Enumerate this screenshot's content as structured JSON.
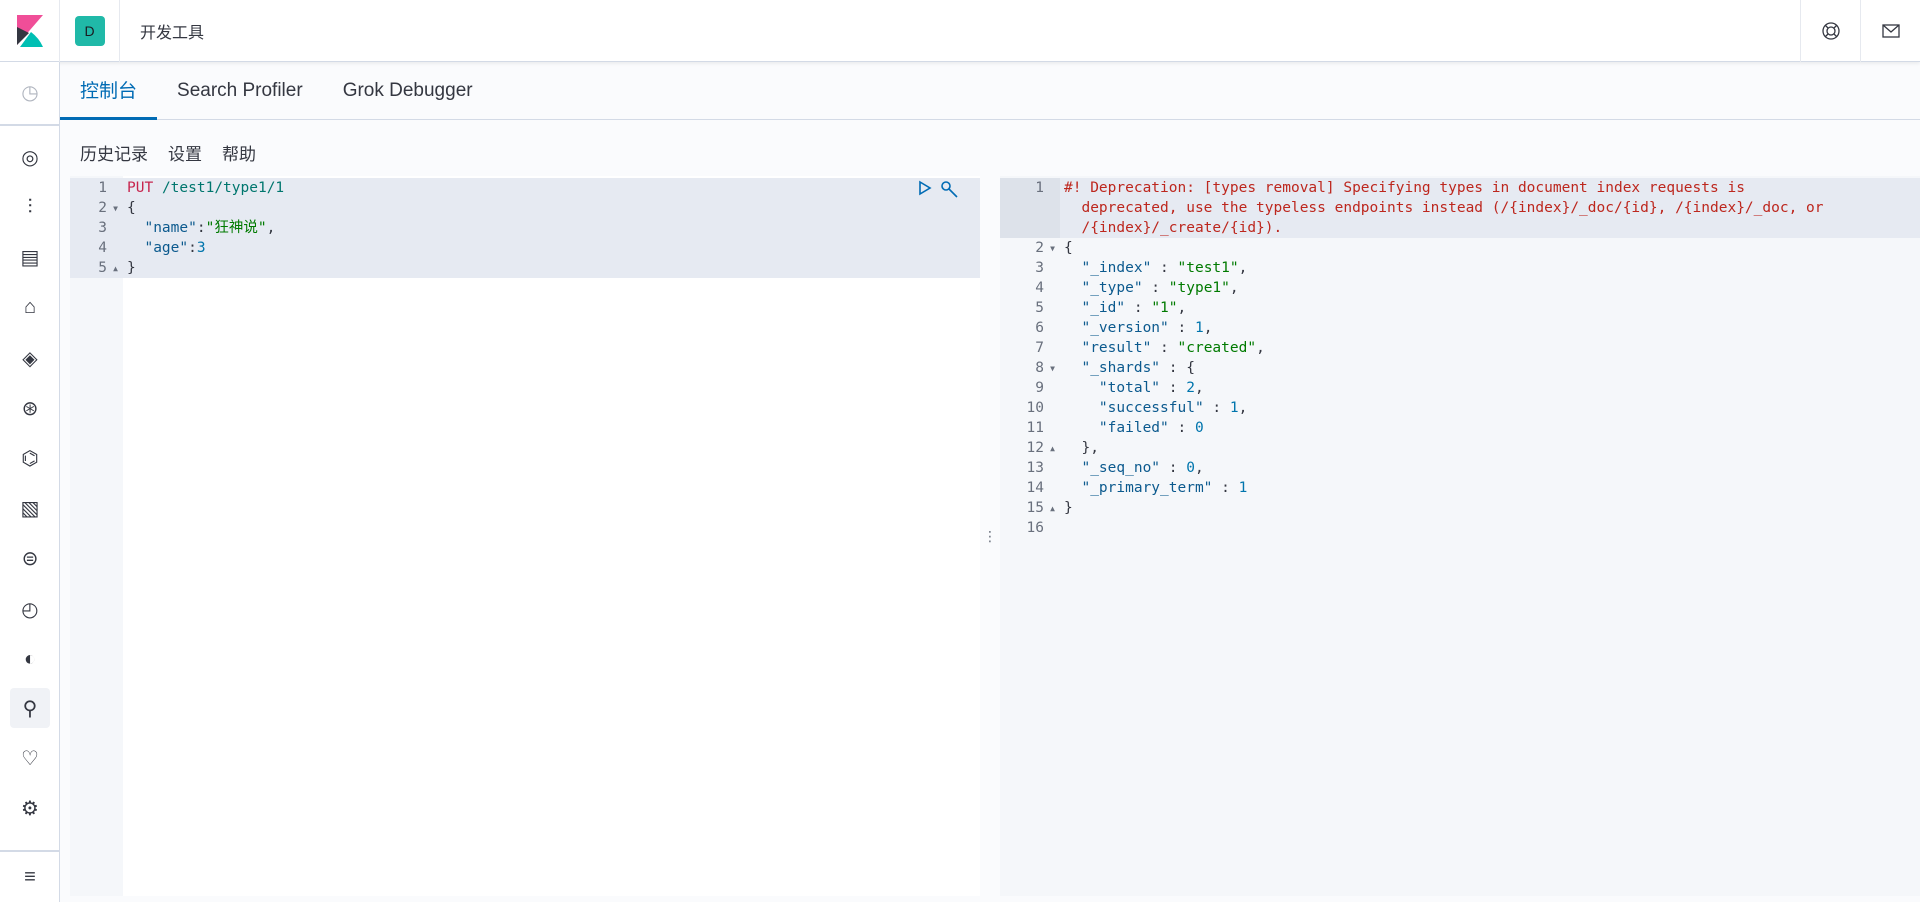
{
  "header": {
    "space_initial": "D",
    "breadcrumb": "开发工具",
    "help_icon": "lifebuoy-icon",
    "mail_icon": "mail-icon"
  },
  "sidebar": {
    "items": [
      "recently-viewed",
      "discover",
      "visualize",
      "dashboard",
      "canvas",
      "maps",
      "machine-learning",
      "infrastructure",
      "logs",
      "apm",
      "uptime",
      "siem",
      "dev-tools",
      "monitoring",
      "management",
      "collapse"
    ],
    "active": "dev-tools"
  },
  "tabs": [
    {
      "label": "控制台",
      "active": true
    },
    {
      "label": "Search Profiler"
    },
    {
      "label": "Grok Debugger"
    }
  ],
  "toolbar": {
    "history": "历史记录",
    "settings": "设置",
    "help": "帮助"
  },
  "request": {
    "lines": [
      [
        [
          "k",
          "PUT"
        ],
        [
          "p",
          " "
        ],
        [
          "u",
          "/test1/type1/1"
        ]
      ],
      [
        [
          "p",
          "{"
        ]
      ],
      [
        [
          "p",
          "  "
        ],
        [
          "key",
          "\"name\""
        ],
        [
          "p",
          ":"
        ],
        [
          "s",
          "\"狂神说\""
        ],
        [
          "p",
          ","
        ]
      ],
      [
        [
          "p",
          "  "
        ],
        [
          "key",
          "\"age\""
        ],
        [
          "p",
          ":"
        ],
        [
          "n",
          "3"
        ]
      ],
      [
        [
          "p",
          "}"
        ]
      ]
    ],
    "folds": {
      "2": "down",
      "5": "up"
    }
  },
  "response": {
    "lines": [
      [
        [
          "c",
          "#! Deprecation: [types removal] Specifying types in document index requests is\n  deprecated, use the typeless endpoints instead (/{index}/_doc/{id}, /{index}/_doc, or\n  /{index}/_create/{id})."
        ]
      ],
      [
        [
          "p",
          "{"
        ]
      ],
      [
        [
          "p",
          "  "
        ],
        [
          "key",
          "\"_index\""
        ],
        [
          "p",
          " : "
        ],
        [
          "s",
          "\"test1\""
        ],
        [
          "p",
          ","
        ]
      ],
      [
        [
          "p",
          "  "
        ],
        [
          "key",
          "\"_type\""
        ],
        [
          "p",
          " : "
        ],
        [
          "s",
          "\"type1\""
        ],
        [
          "p",
          ","
        ]
      ],
      [
        [
          "p",
          "  "
        ],
        [
          "key",
          "\"_id\""
        ],
        [
          "p",
          " : "
        ],
        [
          "s",
          "\"1\""
        ],
        [
          "p",
          ","
        ]
      ],
      [
        [
          "p",
          "  "
        ],
        [
          "key",
          "\"_version\""
        ],
        [
          "p",
          " : "
        ],
        [
          "n",
          "1"
        ],
        [
          "p",
          ","
        ]
      ],
      [
        [
          "p",
          "  "
        ],
        [
          "key",
          "\"result\""
        ],
        [
          "p",
          " : "
        ],
        [
          "s",
          "\"created\""
        ],
        [
          "p",
          ","
        ]
      ],
      [
        [
          "p",
          "  "
        ],
        [
          "key",
          "\"_shards\""
        ],
        [
          "p",
          " : {"
        ]
      ],
      [
        [
          "p",
          "    "
        ],
        [
          "key",
          "\"total\""
        ],
        [
          "p",
          " : "
        ],
        [
          "n",
          "2"
        ],
        [
          "p",
          ","
        ]
      ],
      [
        [
          "p",
          "    "
        ],
        [
          "key",
          "\"successful\""
        ],
        [
          "p",
          " : "
        ],
        [
          "n",
          "1"
        ],
        [
          "p",
          ","
        ]
      ],
      [
        [
          "p",
          "    "
        ],
        [
          "key",
          "\"failed\""
        ],
        [
          "p",
          " : "
        ],
        [
          "n",
          "0"
        ]
      ],
      [
        [
          "p",
          "  },"
        ]
      ],
      [
        [
          "p",
          "  "
        ],
        [
          "key",
          "\"_seq_no\""
        ],
        [
          "p",
          " : "
        ],
        [
          "n",
          "0"
        ],
        [
          "p",
          ","
        ]
      ],
      [
        [
          "p",
          "  "
        ],
        [
          "key",
          "\"_primary_term\""
        ],
        [
          "p",
          " : "
        ],
        [
          "n",
          "1"
        ]
      ],
      [
        [
          "p",
          "}"
        ]
      ],
      [
        [
          "p",
          ""
        ]
      ]
    ],
    "folds": {
      "2": "down",
      "8": "down",
      "12": "up",
      "15": "up"
    }
  }
}
